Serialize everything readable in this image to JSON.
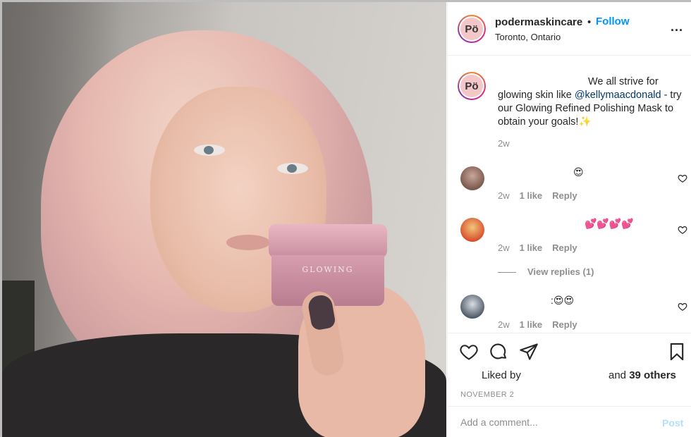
{
  "photo": {
    "jar_brand": "GLOWING"
  },
  "header": {
    "avatar_letters": "Pö",
    "username": "podermaskincare",
    "separator": "•",
    "follow_label": "Follow",
    "location": "Toronto, Ontario",
    "more_label": "..."
  },
  "caption": {
    "avatar_letters": "Pö",
    "text_before": "We all strive for glowing skin like ",
    "mention": "@kellymaacdonald",
    "text_after": " - try our Glowing Refined Polishing Mask to obtain your goals!✨",
    "time": "2w"
  },
  "comments": [
    {
      "text": "😍",
      "time": "2w",
      "likes": "1 like",
      "reply": "Reply"
    },
    {
      "text": "💕💕💕💕",
      "time": "2w",
      "likes": "1 like",
      "reply": "Reply"
    },
    {
      "text": ":😍😍",
      "time": "2w",
      "likes": "1 like",
      "reply": "Reply"
    }
  ],
  "view_replies": "View replies (1)",
  "likes": {
    "prefix": "Liked by",
    "suffix_and": "and ",
    "count": "39 others"
  },
  "date": "NOVEMBER 2",
  "add_comment": {
    "placeholder": "Add a comment...",
    "post_label": "Post"
  },
  "colors": {
    "link_blue": "#0095f6",
    "mention": "#00376b",
    "muted": "#8e8e8e",
    "post_disabled": "#b2dffc"
  }
}
